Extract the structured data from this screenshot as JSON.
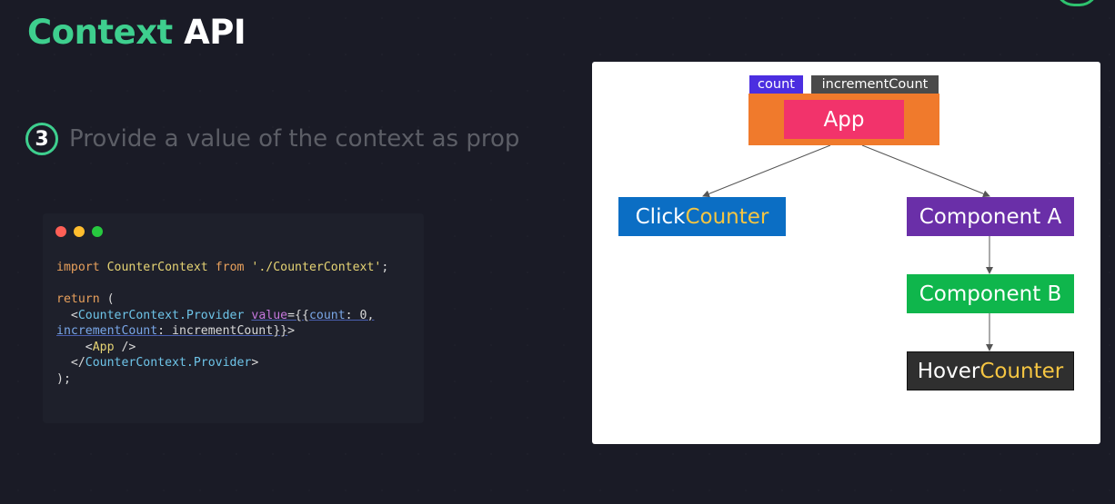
{
  "title": {
    "accent": "Context",
    "rest": "API"
  },
  "step": {
    "number": "3",
    "text": "Provide a value of the context as prop"
  },
  "code": {
    "line1_import": "import",
    "line1_name": "CounterContext",
    "line1_from": "from",
    "line1_path": "'./CounterContext'",
    "line1_end": ";",
    "line2_return": "return",
    "line2_paren": " (",
    "line3_open": "  <",
    "line3_tag": "CounterContext.Provider",
    "line3_attr": "value",
    "line3_eq": "={{",
    "line3_prop": "count",
    "line3_val": ": 0,",
    "line4_prop": "incrementCount",
    "line4_rest": ": incrementCount}}",
    "line4_close": ">",
    "line5_open": "    <",
    "line5_tag": "App",
    "line5_close": " />",
    "line6_open": "  </",
    "line6_tag": "CounterContext.Provider",
    "line6_close": ">",
    "line7": ");"
  },
  "diagram": {
    "count_label": "count",
    "increment_label": "incrementCount",
    "app": "App",
    "click_counter_a": "Click",
    "click_counter_b": "Counter",
    "component_a": "Component A",
    "component_b": "Component B",
    "hover_counter_a": "Hover",
    "hover_counter_b": "Counter"
  },
  "colors": {
    "accent_green": "#3ecf8e",
    "app_outer": "#f07a2c",
    "app_inner": "#f2336b",
    "click_counter": "#0b6ec4",
    "component_a": "#6a2fa8",
    "component_b": "#0fb64c",
    "hover_counter": "#2f2f2f",
    "count_tag": "#4b2ee0",
    "increment_tag": "#4a4a4a"
  }
}
